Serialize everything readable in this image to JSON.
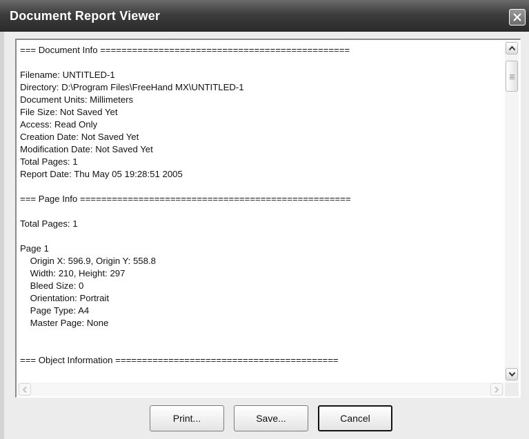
{
  "window": {
    "title": "Document Report Viewer"
  },
  "icons": {
    "close": "close-icon",
    "scroll_up": "arrow-up-icon",
    "scroll_down": "arrow-down-icon",
    "scroll_left": "arrow-left-icon",
    "scroll_right": "arrow-right-icon"
  },
  "report": {
    "lines": [
      "=== Document Info ===============================================",
      "",
      "Filename: UNTITLED-1",
      "Directory: D:\\Program Files\\FreeHand MX\\UNTITLED-1",
      "Document Units: Millimeters",
      "File Size: Not Saved Yet",
      "Access: Read Only",
      "Creation Date: Not Saved Yet",
      "Modification Date: Not Saved Yet",
      "Total Pages: 1",
      "Report Date: Thu May 05 19:28:51 2005",
      "",
      "=== Page Info ===================================================",
      "",
      "Total Pages: 1",
      "",
      "Page 1",
      "    Origin X: 596.9, Origin Y: 558.8",
      "    Width: 210, Height: 297",
      "    Bleed Size: 0",
      "    Orientation: Portrait",
      "    Page Type: A4",
      "    Master Page: None",
      "",
      "",
      "=== Object Information ==========================================",
      ""
    ]
  },
  "buttons": {
    "print": "Print...",
    "save": "Save...",
    "cancel": "Cancel"
  }
}
